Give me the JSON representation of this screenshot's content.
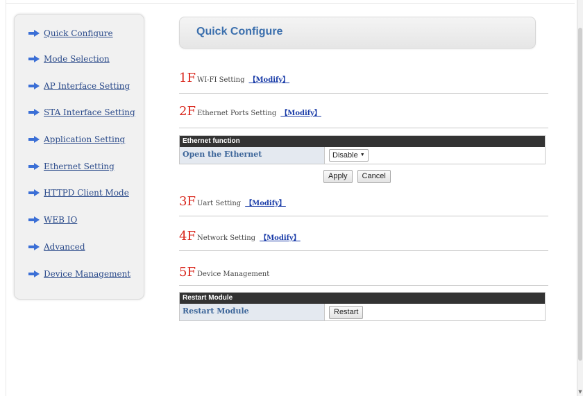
{
  "sidebar": {
    "items": [
      {
        "label": "Quick Configure"
      },
      {
        "label": "Mode Selection"
      },
      {
        "label": "AP Interface Setting"
      },
      {
        "label": "STA Interface Setting"
      },
      {
        "label": "Application Setting"
      },
      {
        "label": "Ethernet Setting"
      },
      {
        "label": "HTTPD Client Mode"
      },
      {
        "label": "WEB IO"
      },
      {
        "label": "Advanced"
      },
      {
        "label": "Device Management"
      }
    ]
  },
  "header": {
    "title": "Quick Configure"
  },
  "sections": [
    {
      "num": "1F",
      "label": "WI-FI Setting",
      "modify": "【Modify】"
    },
    {
      "num": "2F",
      "label": "Ethernet Ports Setting",
      "modify": "【Modify】"
    },
    {
      "num": "3F",
      "label": "Uart Setting",
      "modify": "【Modify】"
    },
    {
      "num": "4F",
      "label": "Network Setting",
      "modify": "【Modify】"
    },
    {
      "num": "5F",
      "label": "Device Management",
      "modify": ""
    }
  ],
  "ethernet_panel": {
    "title": "Ethernet function",
    "row_label": "Open the Ethernet",
    "select_value": "Disable",
    "apply_label": "Apply",
    "cancel_label": "Cancel"
  },
  "restart_panel": {
    "title": "Restart Module",
    "row_label": "Restart Module",
    "button_label": "Restart"
  },
  "colors": {
    "accent": "#3b6fad",
    "section_number": "#d9261c",
    "link": "#1a3ca8",
    "panel_header": "#333333",
    "nav_arrow": "#3b6fd6"
  }
}
